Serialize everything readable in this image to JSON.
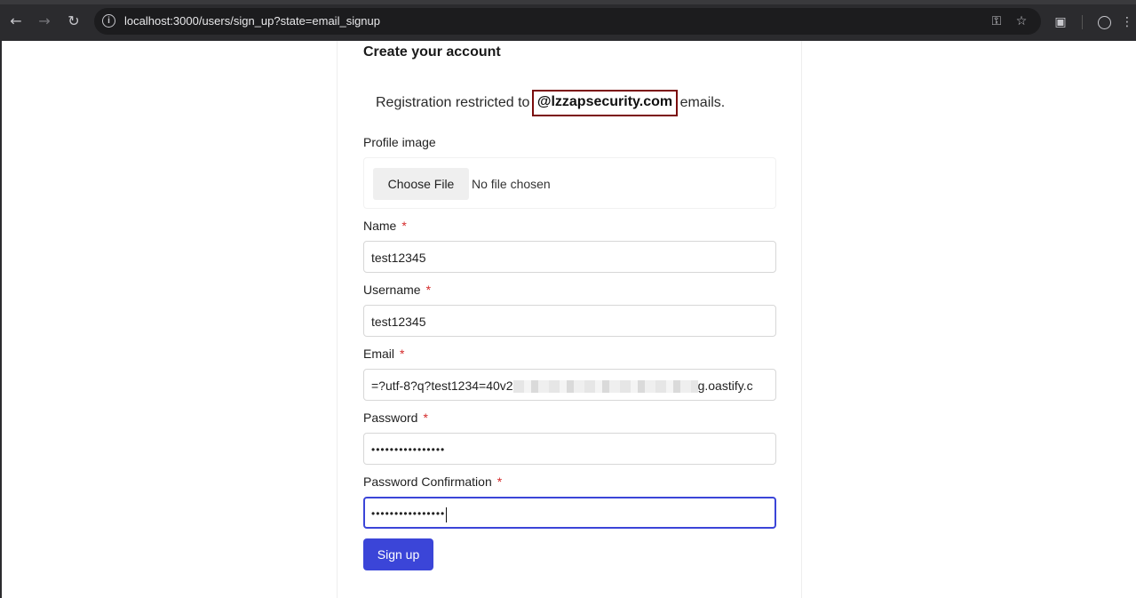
{
  "browser": {
    "url": "localhost:3000/users/sign_up?state=email_signup"
  },
  "form": {
    "title": "Create your account",
    "restriction_prefix": "Registration restricted to",
    "restriction_domain": "@lzzapsecurity.com",
    "restriction_suffix": "emails.",
    "profile_image_label": "Profile image",
    "choose_file_label": "Choose File",
    "file_status": "No file chosen",
    "required_marker": "*",
    "name_label": "Name",
    "name_value": "test12345",
    "username_label": "Username",
    "username_value": "test12345",
    "email_label": "Email",
    "email_value_start": "=?utf-8?q?test1234=40v2",
    "email_value_end": "g.oastify.c",
    "password_label": "Password",
    "password_value": "••••••••••••••••",
    "password_confirmation_label": "Password Confirmation",
    "password_confirmation_value": "••••••••••••••••",
    "submit_label": "Sign up"
  },
  "colors": {
    "primary": "#3b45d8",
    "required": "#d42a2a",
    "highlight_box": "#7b0d0d"
  }
}
